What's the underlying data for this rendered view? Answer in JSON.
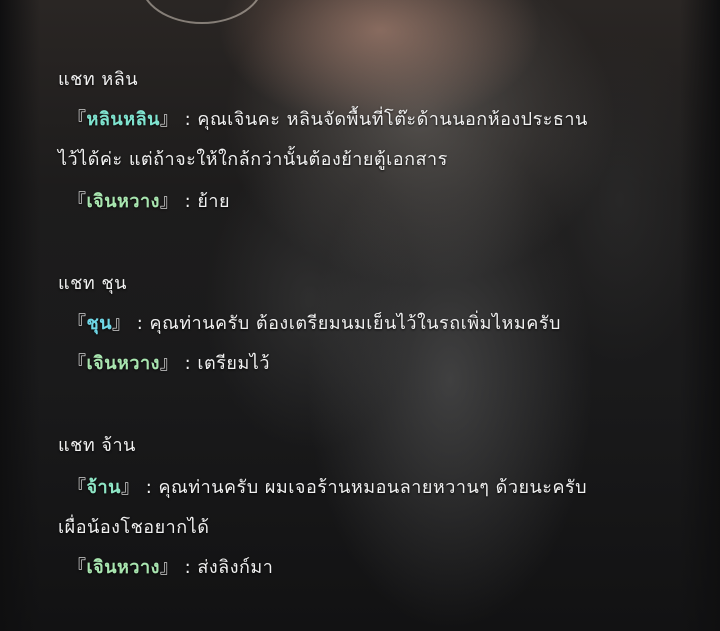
{
  "colors": {
    "text": "#f1f1f1",
    "speaker_lin": "#7fe3cf",
    "speaker_yinhuang": "#a9e6b0",
    "speaker_chun": "#6fd8e8",
    "speaker_chuan": "#8fe6c6"
  },
  "sections": [
    {
      "heading": "แชท หลิน",
      "messages": [
        {
          "speaker": "หลินหลิน",
          "text": " : คุณเจินคะ หลินจัดพื้นที่โต๊ะด้านนอกห้องประธาน",
          "continuation": "ไว้ได้ค่ะ แต่ถ้าจะให้ใกล้กว่านั้นต้องย้ายตู้เอกสาร"
        },
        {
          "speaker": "เจินหวาง",
          "text": " : ย้าย"
        }
      ]
    },
    {
      "heading": "แชท ชุน",
      "messages": [
        {
          "speaker": "ชุน",
          "text": " : คุณท่านครับ ต้องเตรียมนมเย็นไว้ในรถเพิ่มไหมครับ"
        },
        {
          "speaker": "เจินหวาง",
          "text": " : เตรียมไว้"
        }
      ]
    },
    {
      "heading": "แชท จ้าน",
      "messages": [
        {
          "speaker": "จ้าน",
          "text": " : คุณท่านครับ ผมเจอร้านหมอนลายหวานๆ ด้วยนะครับ",
          "continuation": "เผื่อน้องโชอยากได้"
        },
        {
          "speaker": "เจินหวาง",
          "text": " : ส่งลิงก์มา"
        }
      ]
    }
  ],
  "brackets": {
    "open": "『",
    "close": "』"
  }
}
